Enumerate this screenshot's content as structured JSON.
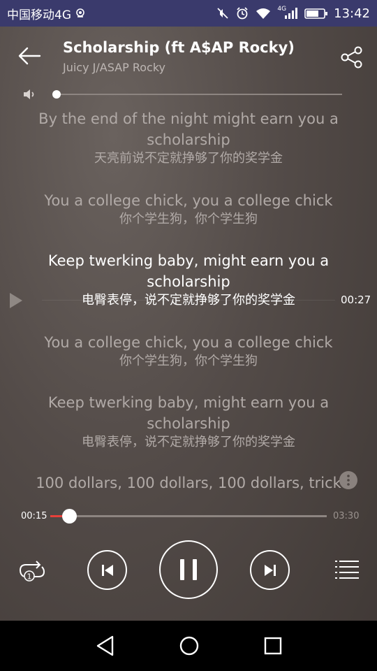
{
  "status_bar": {
    "carrier": "中国移动4G",
    "network_small": "4G",
    "time": "13:42",
    "icons": [
      "location-icon",
      "mute-icon",
      "alarm-icon",
      "wifi-icon",
      "signal-icon",
      "battery-icon"
    ]
  },
  "header": {
    "title": "Scholarship (ft A$AP Rocky)",
    "artist": "Juicy J/ASAP Rocky",
    "back_icon": "arrow-left-icon",
    "share_icon": "share-icon"
  },
  "volume": {
    "icon": "speaker-icon",
    "level": 0.0
  },
  "lyrics": [
    {
      "en": "By the end of the night might earn you a scholarship",
      "zh": "天亮前说不定就挣够了你的奖学金",
      "current": false
    },
    {
      "en": "You a college chick, you a college chick",
      "zh": "你个学生狗，你个学生狗",
      "current": false
    },
    {
      "en": "Keep twerking baby, might earn you a scholarship",
      "zh": "电臀表停，说不定就挣够了你的奖学金",
      "current": true
    },
    {
      "en": "You a college chick, you a college chick",
      "zh": "你个学生狗，你个学生狗",
      "current": false
    },
    {
      "en": "Keep twerking baby, might earn you a scholarship",
      "zh": "电臀表停，说不定就挣够了你的奖学金",
      "current": false
    },
    {
      "en": "100 dollars, 100 dollars, 100 dollars, trick",
      "zh": "",
      "current": false
    }
  ],
  "seek_indicator": {
    "time": "00:27",
    "icon": "play-triangle-icon"
  },
  "more_icon": "more-vertical-icon",
  "playback": {
    "current_time": "00:15",
    "total_time": "03:30",
    "progress": 0.0714,
    "accent_color": "#e8403a"
  },
  "controls": {
    "repeat_icon": "repeat-one-icon",
    "repeat_badge": "1",
    "prev_icon": "skip-previous-icon",
    "pause_icon": "pause-icon",
    "next_icon": "skip-next-icon",
    "playlist_icon": "playlist-icon"
  },
  "nav_bar": {
    "back_icon": "nav-back-triangle-icon",
    "home_icon": "nav-home-circle-icon",
    "recent_icon": "nav-recent-square-icon"
  }
}
